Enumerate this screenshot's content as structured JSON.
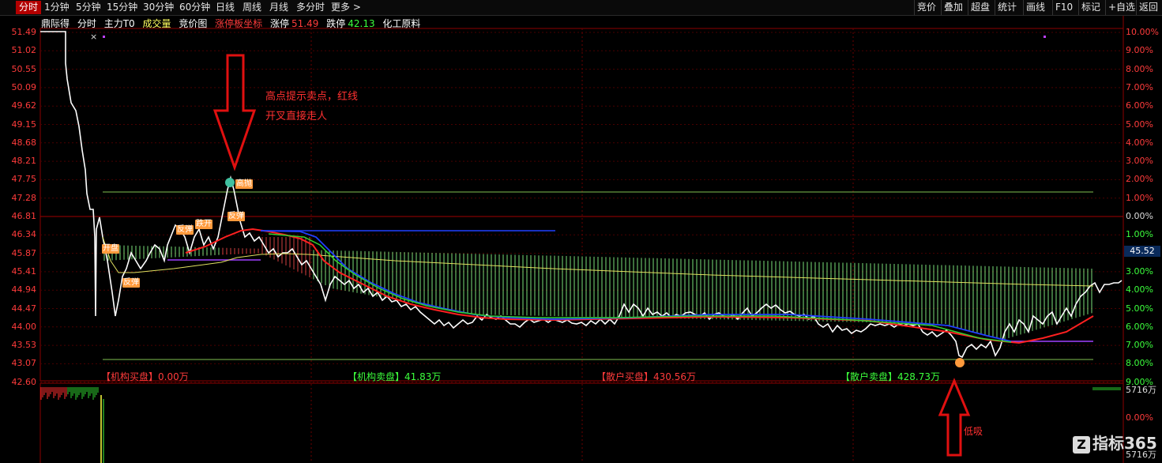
{
  "toolbar": {
    "tabs": [
      "分时",
      "1分钟",
      "5分钟",
      "15分钟",
      "30分钟",
      "60分钟",
      "日线",
      "周线",
      "月线",
      "多分时",
      "更多 >"
    ],
    "right_buttons": [
      "竞价",
      "叠加",
      "超盘",
      "统计",
      "画线",
      "F10",
      "标记",
      "+自选",
      "返回"
    ]
  },
  "info": {
    "stock_name": "鼎际得",
    "items": [
      "分时",
      "主力T0",
      "成交量",
      "竞价图"
    ],
    "subtitle": "涨停板坐标",
    "limit_up_label": "涨停",
    "limit_up_value": "51.49",
    "limit_down_label": "跌停",
    "limit_down_value": "42.13",
    "sector": "化工原料",
    "colors": {
      "red": "#ff3b3b",
      "green": "#3cff3c",
      "yellow": "#ffff60"
    }
  },
  "price_axis": [
    "51.49",
    "51.02",
    "50.55",
    "50.09",
    "49.62",
    "49.15",
    "48.68",
    "48.21",
    "47.75",
    "47.28",
    "46.81",
    "46.34",
    "45.87",
    "45.41",
    "44.94",
    "44.47",
    "44.00",
    "43.53",
    "43.07",
    "42.60"
  ],
  "pct_axis": [
    "10.00%",
    "9.00%",
    "8.00%",
    "7.00%",
    "6.00%",
    "5.00%",
    "4.00%",
    "3.00%",
    "2.00%",
    "1.00%",
    "0.00%",
    "1.00%",
    "2.00%",
    "3.00%",
    "4.00%",
    "5.00%",
    "6.00%",
    "7.00%",
    "8.00%",
    "9.00%"
  ],
  "current_price": "45.52",
  "bottom_labels": [
    {
      "label": "【机构买盘】",
      "value": "0.00万",
      "color": "#ff3b3b"
    },
    {
      "label": "【机构卖盘】",
      "value": "41.83万",
      "color": "#3cff3c"
    },
    {
      "label": "【散户买盘】",
      "value": "430.56万",
      "color": "#ff3b3b"
    },
    {
      "label": "【散户卖盘】",
      "value": "428.73万",
      "color": "#3cff3c"
    }
  ],
  "annotation": {
    "line1": "高点提示卖点，红线",
    "line2": "开叉直接走人"
  },
  "low_annotation": "低吸",
  "badges": [
    "开盘",
    "反弹",
    "反弹",
    "跌开",
    "反弹",
    "高抛"
  ],
  "volume_axis": [
    "5716万",
    "0.00%",
    "5716万"
  ],
  "close_mark": "×",
  "watermark": "指标365"
}
